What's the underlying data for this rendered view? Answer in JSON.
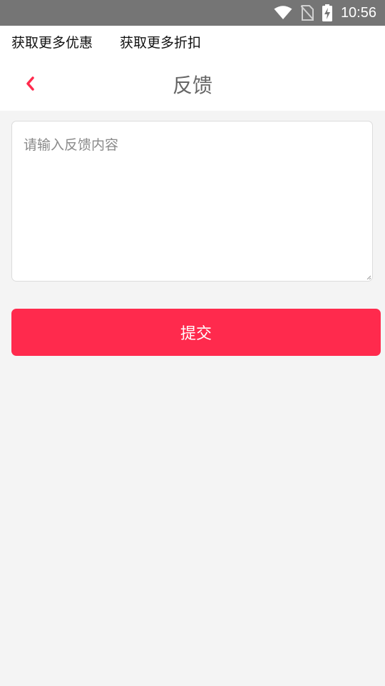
{
  "status_bar": {
    "time": "10:56",
    "icons": [
      "wifi-icon",
      "no-sim-icon",
      "battery-charging-icon"
    ]
  },
  "promo_bar": {
    "link_1": "获取更多优惠",
    "link_2": "获取更多折扣"
  },
  "nav": {
    "title": "反馈",
    "back_icon": "chevron-left-icon"
  },
  "feedback": {
    "placeholder": "请输入反馈内容",
    "value": ""
  },
  "submit": {
    "label": "提交"
  },
  "colors": {
    "accent": "#ff2a4d",
    "background": "#f4f4f4",
    "status_bar": "#757575"
  }
}
